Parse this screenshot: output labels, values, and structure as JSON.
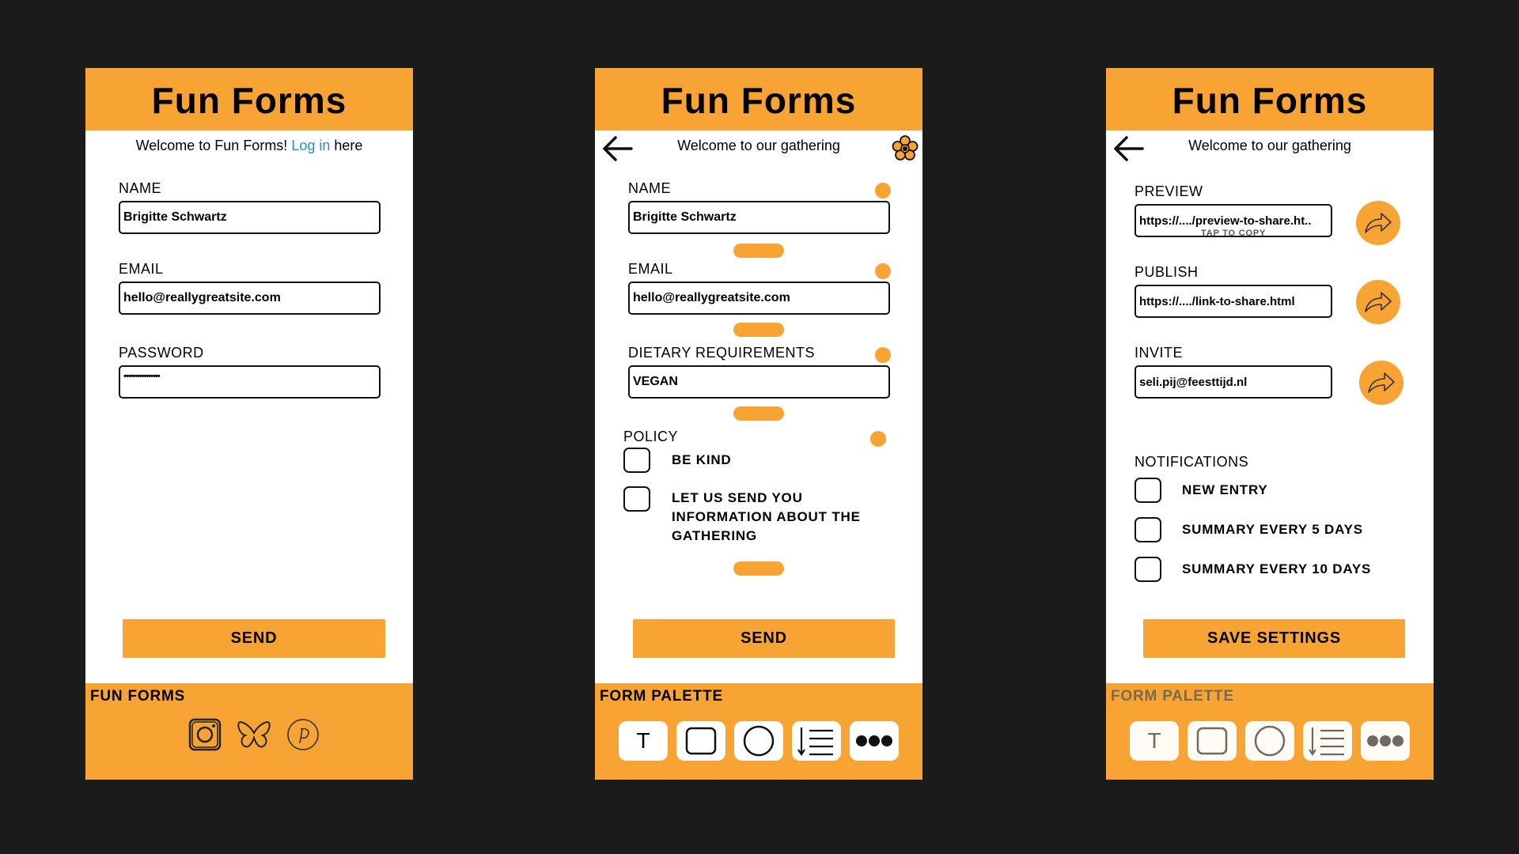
{
  "colors": {
    "accent": "#f8a434",
    "background": "#1b1b1b",
    "link": "#2a8ac8"
  },
  "s1": {
    "title": "Fun Forms",
    "welcome_prefix": "Welcome to Fun Forms! ",
    "welcome_link": "Log in",
    "welcome_suffix": " here",
    "name_label": "NAME",
    "name_value": "Brigitte Schwartz",
    "email_label": "EMAIL",
    "email_value": "hello@reallygreatsite.com",
    "password_label": "PASSWORD",
    "password_value": "••••••••••••••••",
    "send_label": "SEND",
    "footer_title": "FUN FORMS",
    "social_icons": [
      "instagram-icon",
      "butterfly-icon",
      "pinterest-icon"
    ]
  },
  "s2": {
    "title": "Fun Forms",
    "welcome": "Welcome to our gathering",
    "name_label": "NAME",
    "name_value": "Brigitte Schwartz",
    "email_label": "EMAIL",
    "email_value": "hello@reallygreatsite.com",
    "diet_label": "DIETARY REQUIREMENTS",
    "diet_value": "VEGAN",
    "policy_label": "POLICY",
    "policy_items": [
      "BE KIND",
      "LET US SEND YOU INFORMATION ABOUT THE GATHERING"
    ],
    "send_label": "SEND",
    "footer_title": "FORM PALETTE",
    "tool_text": "T"
  },
  "s3": {
    "title": "Fun Forms",
    "welcome": "Welcome to our gathering",
    "preview_label": "PREVIEW",
    "preview_value": "https://..../preview-to-share.ht..",
    "preview_hint": "TAP TO COPY",
    "publish_label": "PUBLISH",
    "publish_value": "https://..../link-to-share.html",
    "invite_label": "INVITE",
    "invite_value": "seli.pij@feesttijd.nl",
    "notifications_label": "NOTIFICATIONS",
    "notification_items": [
      "NEW ENTRY",
      "SUMMARY EVERY 5 DAYS",
      "SUMMARY EVERY 10 DAYS"
    ],
    "save_label": "SAVE SETTINGS",
    "footer_title": "FORM PALETTE",
    "tool_text": "T"
  }
}
